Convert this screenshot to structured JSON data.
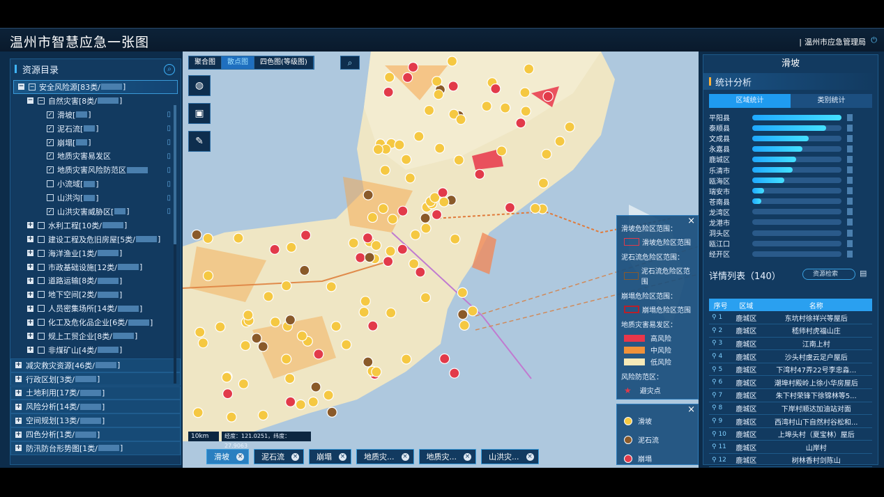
{
  "header": {
    "title": "温州市智慧应急一张图",
    "org": "温州市应急管理局"
  },
  "left": {
    "title": "资源目录",
    "tree": [
      {
        "level": 0,
        "expand": "−",
        "checkbox": "−",
        "label": "安全风险源[83类/",
        "tail": "]",
        "selected": true
      },
      {
        "level": 1,
        "expand": "−",
        "checkbox": "−",
        "label": "自然灾害[8类/",
        "tail": "]"
      },
      {
        "level": 2,
        "checkbox": "✓",
        "label": "滑坡[",
        "tail": "]",
        "doc": true
      },
      {
        "level": 2,
        "checkbox": "✓",
        "label": "泥石流[",
        "tail": "]",
        "doc": true
      },
      {
        "level": 2,
        "checkbox": "✓",
        "label": "崩塌[",
        "tail": "]",
        "doc": true
      },
      {
        "level": 2,
        "checkbox": "✓",
        "label": "地质灾害易发区",
        "tail": "",
        "doc": true
      },
      {
        "level": 2,
        "checkbox": "✓",
        "label": "地质灾害风险防范区",
        "tail": "",
        "doc": true
      },
      {
        "level": 2,
        "checkbox": "",
        "label": "小流域[",
        "tail": "]",
        "doc": true
      },
      {
        "level": 2,
        "checkbox": "",
        "label": "山洪沟[",
        "tail": "]",
        "doc": true
      },
      {
        "level": 2,
        "checkbox": "✓",
        "label": "山洪灾害威胁区[",
        "tail": "]",
        "doc": true
      },
      {
        "level": 1,
        "expand": "+",
        "checkbox": "",
        "label": "水利工程[10类/",
        "tail": "]"
      },
      {
        "level": 1,
        "expand": "+",
        "checkbox": "",
        "label": "建设工程及危旧房屋[5类/",
        "tail": "]"
      },
      {
        "level": 1,
        "expand": "+",
        "checkbox": "",
        "label": "海洋渔业[1类/",
        "tail": "]"
      },
      {
        "level": 1,
        "expand": "+",
        "checkbox": "",
        "label": "市政基础设施[12类/",
        "tail": "]"
      },
      {
        "level": 1,
        "expand": "+",
        "checkbox": "",
        "label": "道路运输[8类/",
        "tail": "]"
      },
      {
        "level": 1,
        "expand": "+",
        "checkbox": "",
        "label": "地下空间[2类/",
        "tail": "]"
      },
      {
        "level": 1,
        "expand": "+",
        "checkbox": "",
        "label": "人员密集场所[14类/",
        "tail": "]"
      },
      {
        "level": 1,
        "expand": "+",
        "checkbox": "",
        "label": "化工及危化品企业[6类/",
        "tail": "]"
      },
      {
        "level": 1,
        "expand": "+",
        "checkbox": "",
        "label": "规上工贸企业[8类/",
        "tail": "]"
      },
      {
        "level": 1,
        "expand": "+",
        "checkbox": "",
        "label": "非煤矿山[4类/",
        "tail": "]"
      }
    ],
    "sections": [
      {
        "label": "减灾救灾资源[46类/",
        "tail": "]"
      },
      {
        "label": "行政区划[3类/",
        "tail": "]"
      },
      {
        "label": "土地利用[17类/",
        "tail": "]"
      },
      {
        "label": "风险分析[14类/",
        "tail": "]"
      },
      {
        "label": "空间规划[13类/",
        "tail": "]"
      },
      {
        "label": "四色分析[1类/",
        "tail": "]"
      },
      {
        "label": "防汛防台形势图[1类/",
        "tail": "]"
      }
    ]
  },
  "map": {
    "tabs": [
      "聚合图",
      "散点图",
      "四色图(等级图)"
    ],
    "active_tab": 1,
    "scale": "10km",
    "coord": "经度：121.0251，纬度：27.9063",
    "chips": [
      "滑坡",
      "泥石流",
      "崩塌",
      "地质灾...",
      "地质灾...",
      "山洪灾..."
    ],
    "legend1": {
      "s1": "滑坡危险区范围：",
      "s1_item": "滑坡危险区范围",
      "s2": "泥石流危险区范围：",
      "s2_item": "泥石流危险区范围",
      "s3": "崩塌危险区范围：",
      "s3_item": "崩塌危险区范围",
      "s4": "地质灾害易发区：",
      "high": "高风险",
      "mid": "中风险",
      "low": "低风险",
      "s5": "风险防范区：",
      "avoid": "避灾点"
    },
    "legend2": [
      "滑坡",
      "泥石流",
      "崩塌"
    ],
    "colors": {
      "high": "#e8364a",
      "mid": "#f0923a",
      "low": "#f7eab8",
      "landslide": "#f5c842",
      "debris": "#8a5a2a",
      "collapse": "#e23a4a"
    }
  },
  "right": {
    "title": "滑坡",
    "stats_title": "统计分析",
    "tabs": [
      "区域统计",
      "类别统计"
    ],
    "stats": [
      {
        "name": "平阳县",
        "pct": 1.0
      },
      {
        "name": "泰顺县",
        "pct": 0.83
      },
      {
        "name": "文成县",
        "pct": 0.63
      },
      {
        "name": "永嘉县",
        "pct": 0.56
      },
      {
        "name": "鹿城区",
        "pct": 0.49
      },
      {
        "name": "乐清市",
        "pct": 0.45
      },
      {
        "name": "瓯海区",
        "pct": 0.36
      },
      {
        "name": "瑞安市",
        "pct": 0.13
      },
      {
        "name": "苍南县",
        "pct": 0.1
      },
      {
        "name": "龙湾区",
        "pct": 0.0
      },
      {
        "name": "龙港市",
        "pct": 0.0
      },
      {
        "name": "洞头区",
        "pct": 0.0
      },
      {
        "name": "瓯江口",
        "pct": 0.0
      },
      {
        "name": "经开区",
        "pct": 0.0
      }
    ],
    "list_title": "详情列表（140）",
    "search_placeholder": "资源检索",
    "columns": [
      "序号",
      "区域",
      "名称"
    ],
    "rows": [
      [
        "1",
        "鹿城区",
        "东坑村徐祥兴等屋后"
      ],
      [
        "2",
        "鹿城区",
        "嵇师村虎福山庄"
      ],
      [
        "3",
        "鹿城区",
        "江南上村"
      ],
      [
        "4",
        "鹿城区",
        "沙头村虞云足户屋后"
      ],
      [
        "5",
        "鹿城区",
        "下湾村47弄22号李忠淼..."
      ],
      [
        "6",
        "鹿城区",
        "潮埠村殿岭上徐小华房屋后"
      ],
      [
        "7",
        "鹿城区",
        "朱下村荣锋下徐锦林等5..."
      ],
      [
        "8",
        "鹿城区",
        "下岸村顺达加油站对面"
      ],
      [
        "9",
        "鹿城区",
        "西湾村山下自然村谷松和..."
      ],
      [
        "10",
        "鹿城区",
        "上埠头村（夏宝林）屋后"
      ],
      [
        "11",
        "鹿城区",
        "山岸村"
      ],
      [
        "12",
        "鹿城区",
        "树林香村剑陈山"
      ]
    ]
  }
}
